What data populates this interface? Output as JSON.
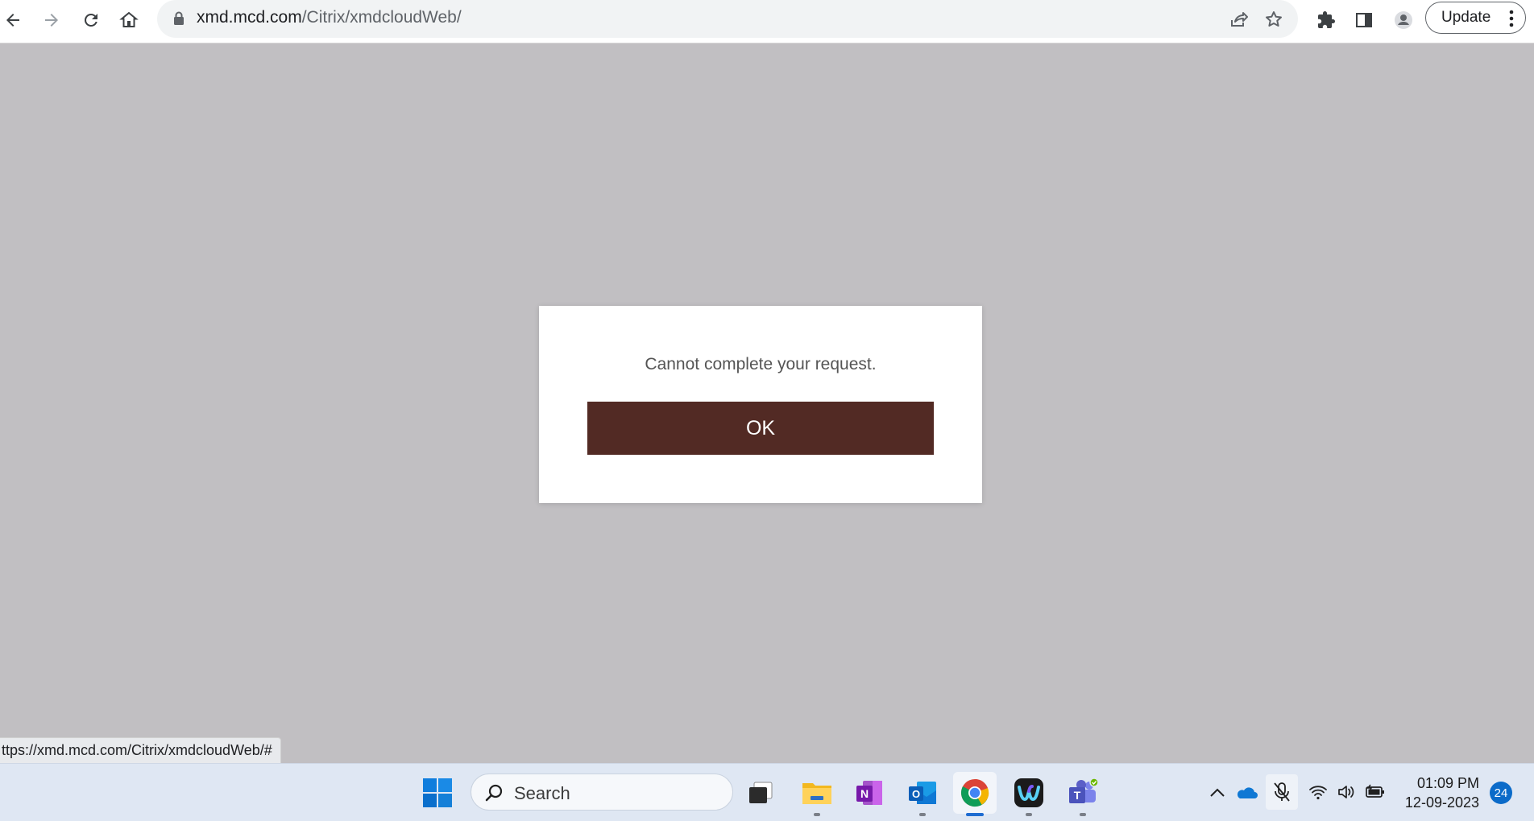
{
  "browser": {
    "url_host": "xmd.mcd.com",
    "url_path": "/Citrix/xmdcloudWeb/",
    "update_label": "Update",
    "icons": [
      "back-arrow-icon",
      "forward-arrow-icon",
      "reload-icon",
      "home-icon",
      "lock-icon",
      "share-icon",
      "star-icon",
      "extensions-icon",
      "side-panel-icon",
      "profile-icon",
      "more-vert-icon"
    ]
  },
  "dialog": {
    "message": "Cannot complete your request.",
    "ok_label": "OK",
    "button_color": "#522a24"
  },
  "status_bar": {
    "hover_url": "ttps://xmd.mcd.com/Citrix/xmdcloudWeb/#"
  },
  "taskbar": {
    "search_label": "Search",
    "apps": [
      "windows-start-icon",
      "task-view-icon",
      "file-explorer-icon",
      "onenote-icon",
      "outlook-icon",
      "chrome-icon",
      "webex-icon",
      "teams-icon"
    ],
    "tray_icons": [
      "chevron-up-icon",
      "onedrive-icon",
      "mic-muted-icon",
      "wifi-icon",
      "volume-icon",
      "battery-icon"
    ],
    "time": "01:09 PM",
    "date": "12-09-2023",
    "notification_count": "24"
  }
}
